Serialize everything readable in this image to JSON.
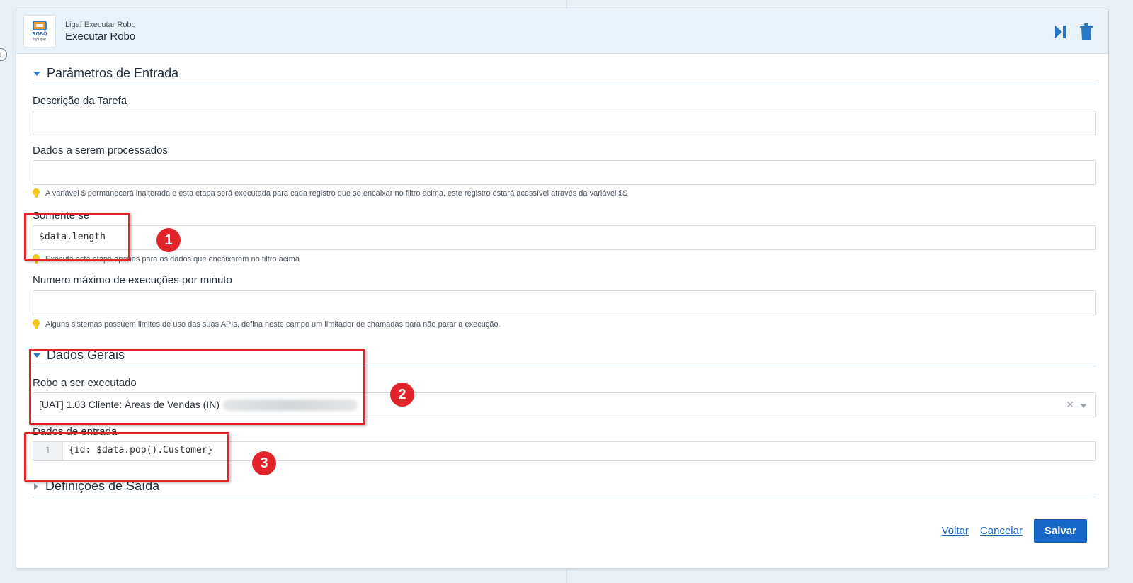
{
  "header": {
    "logo_line1": "ROBÔ",
    "logo_line2": "by Ligaí",
    "subtitle": "Ligaí Executar Robo",
    "title": "Executar Robo"
  },
  "sections": {
    "entrada": {
      "title": "Parâmetros de Entrada",
      "descricao_label": "Descrição da Tarefa",
      "descricao_value": "",
      "dados_label": "Dados a serem processados",
      "dados_value": "",
      "dados_hint": "A variável $ permanecerá inalterada e esta etapa será executada para cada registro que se encaixar no filtro acima, este registro estará acessível através da variável $$",
      "somente_label": "Somente se",
      "somente_value": "$data.length",
      "somente_hint": "Executa esta etapa apenas para os dados que encaixarem no filtro acima",
      "max_label": "Numero máximo de execuções por minuto",
      "max_value": "",
      "max_hint": "Alguns sistemas possuem limites de uso das suas APIs, defina neste campo um limitador de chamadas para não parar a execução."
    },
    "gerais": {
      "title": "Dados Gerais",
      "robo_label": "Robo a ser executado",
      "robo_value": "[UAT] 1.03 Cliente: Áreas de Vendas (IN)",
      "entrada_label": "Dados de entrada",
      "entrada_line_no": "1",
      "entrada_code": "{id: $data.pop().Customer}"
    },
    "saida": {
      "title": "Definições de Saída"
    }
  },
  "annotations": [
    "1",
    "2",
    "3"
  ],
  "footer": {
    "voltar": "Voltar",
    "cancelar": "Cancelar",
    "salvar": "Salvar"
  },
  "colors": {
    "accent": "#1667c7",
    "annotation": "#e2232a",
    "hint_icon": "#f5c518"
  }
}
